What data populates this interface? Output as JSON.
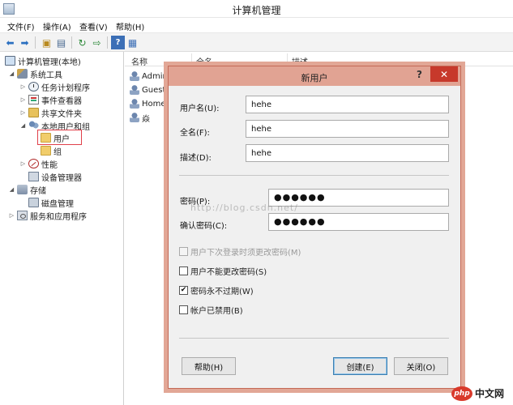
{
  "window": {
    "title": "计算机管理"
  },
  "menu": [
    "文件(F)",
    "操作(A)",
    "查看(V)",
    "帮助(H)"
  ],
  "toolbar": {
    "buttons": [
      "back-icon",
      "forward-icon",
      "up-folder-icon",
      "show-hide-tree-icon",
      "refresh-icon",
      "export-list-icon",
      "help-icon",
      "properties-icon"
    ]
  },
  "tree": {
    "root": "计算机管理(本地)",
    "system_tools": "系统工具",
    "task_scheduler": "任务计划程序",
    "event_viewer": "事件查看器",
    "shared_folders": "共享文件夹",
    "local_users_groups": "本地用户和组",
    "users": "用户",
    "groups": "组",
    "performance": "性能",
    "device_manager": "设备管理器",
    "storage": "存储",
    "disk_management": "磁盘管理",
    "services_apps": "服务和应用程序"
  },
  "list": {
    "headers": [
      "名称",
      "全名",
      "描述"
    ],
    "rows": [
      "Admini",
      "Guest",
      "HomeG",
      "焱"
    ]
  },
  "dialog": {
    "title": "新用户",
    "help": "?",
    "close": "✕",
    "username_label": "用户名(U):",
    "username_value": "hehe",
    "fullname_label": "全名(F):",
    "fullname_value": "hehe",
    "description_label": "描述(D):",
    "description_value": "hehe",
    "password_label": "密码(P):",
    "password_value": "●●●●●●",
    "confirm_label": "确认密码(C):",
    "confirm_value": "●●●●●●",
    "options": [
      {
        "label": "用户下次登录时须更改密码(M)",
        "checked": false,
        "disabled": true
      },
      {
        "label": "用户不能更改密码(S)",
        "checked": false,
        "disabled": false
      },
      {
        "label": "密码永不过期(W)",
        "checked": true,
        "disabled": false
      },
      {
        "label": "帐户已禁用(B)",
        "checked": false,
        "disabled": false
      }
    ],
    "help_button": "帮助(H)",
    "create_button": "创建(E)",
    "close_button": "关闭(O)"
  },
  "watermark": "http://blog.csdn.net/",
  "brand": {
    "logo": "php",
    "text": "中文网"
  }
}
